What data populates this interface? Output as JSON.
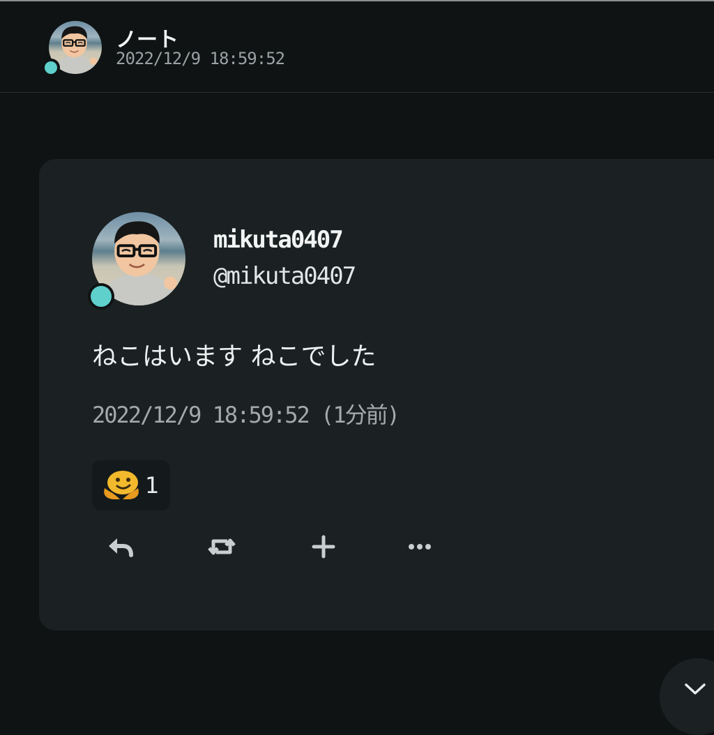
{
  "header": {
    "title": "ノート",
    "timestamp": "2022/12/9 18:59:52"
  },
  "note": {
    "display_name": "mikuta0407",
    "handle": "@mikuta0407",
    "text": "ねこはいます ねこでした",
    "timestamp": "2022/12/9 18:59:52 (1分前)",
    "reaction": {
      "icon": "hugging-face-emoji",
      "count": "1"
    },
    "actions": [
      "reply-icon",
      "renote-icon",
      "add-reaction-icon",
      "more-icon"
    ]
  },
  "scroll_button": {
    "icon": "chevron-down-icon"
  },
  "colors": {
    "background": "#0f1314",
    "card": "#1b2122",
    "online": "#5fd0cc",
    "muted_text": "#a3aaac"
  }
}
